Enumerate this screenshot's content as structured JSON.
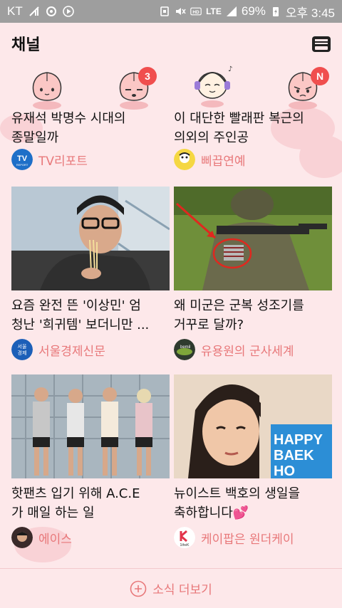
{
  "status_bar": {
    "carrier": "KT",
    "network": "LTE",
    "battery": "69%",
    "time": "오후 3:45"
  },
  "header": {
    "title": "채널"
  },
  "characters": [
    {
      "name": "peach-character-icon",
      "badge": ""
    },
    {
      "name": "peach-sleepy-character-icon",
      "badge": "3"
    },
    {
      "name": "headphone-character-icon",
      "badge": ""
    },
    {
      "name": "peach-angry-character-icon",
      "badge": "N"
    }
  ],
  "cards": [
    {
      "title": "유재석 박명수 시대의\n종말일까",
      "source": "TV리포트"
    },
    {
      "title": "이 대단한 빨래판 복근의\n의외의 주인공",
      "source": "삐끕연예"
    },
    {
      "title": "요즘 완전 뜬 '이상민' 엄\n청난 '희귀템' 보더니만 ...",
      "source": "서울경제신문"
    },
    {
      "title": "왜 미군은 군복 성조기를\n거꾸로 달까?",
      "source": "유용원의 군사세계"
    },
    {
      "title": "핫팬츠 입기 위해 A.C.E\n가 매일 하는 일",
      "source": "에이스"
    },
    {
      "title": "뉴이스트 백호의 생일을\n축하합니다💕",
      "source": "케이팝은 원더케이"
    }
  ],
  "logos": {
    "tv_report": "TV",
    "tv_report_sub": "REPORT",
    "seoul_econ": "서울\n경제",
    "one_the_k": "1theK"
  },
  "thumb_text": {
    "happy": "HAPPY",
    "baek": "BAEK",
    "ho": "HO"
  },
  "more_button": {
    "label": "소식 더보기"
  },
  "colors": {
    "accent": "#e8787a",
    "background": "#fde8ea",
    "badge": "#f04e4e"
  }
}
